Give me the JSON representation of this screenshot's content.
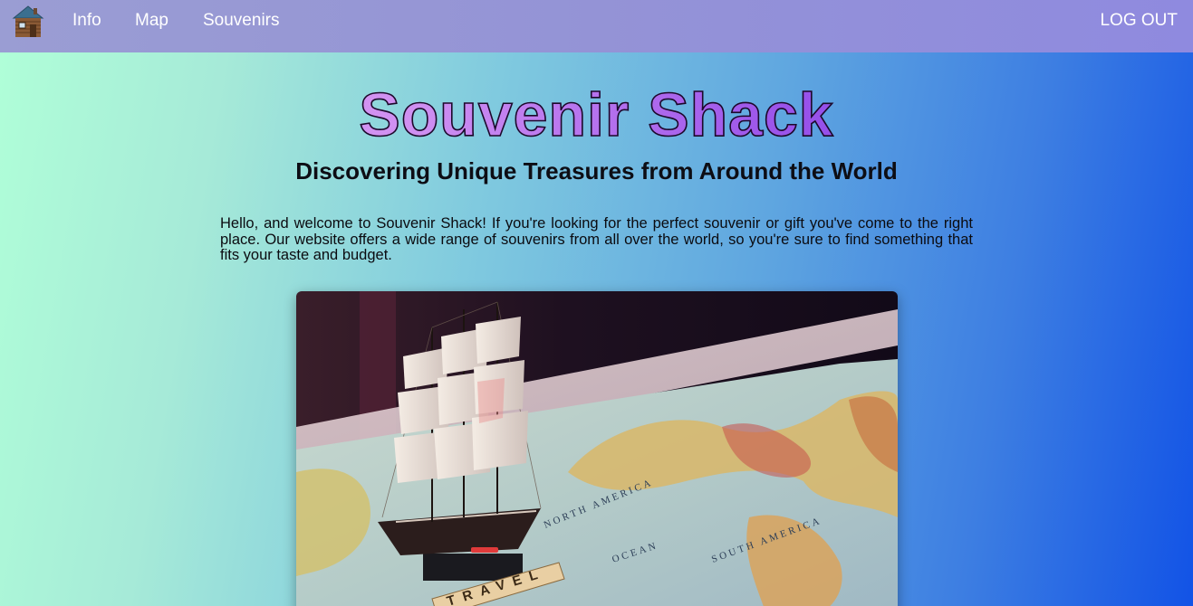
{
  "nav": {
    "logo_icon": "log-cabin-icon",
    "links": [
      {
        "label": "Info"
      },
      {
        "label": "Map"
      },
      {
        "label": "Souvenirs"
      }
    ],
    "logout_label": "LOG OUT"
  },
  "header": {
    "title": "Souvenir Shack",
    "subtitle": "Discovering Unique Treasures from Around the World"
  },
  "intro": {
    "text": "Hello, and welcome to Souvenir Shack! If you're looking for the perfect souvenir or gift you've come to the right place. Our website offers a wide range of souvenirs from all over the world, so you're sure to find something that fits your taste and budget."
  },
  "hero": {
    "image": "model-ship-on-world-map-image",
    "map_labels": [
      "NORTH AMERICA",
      "OCEAN",
      "SOUTH AMERICA"
    ],
    "tile_word": "TRAVEL"
  },
  "colors": {
    "nav_background": "#9595d6",
    "title_start": "#e7a6f4",
    "title_end": "#6c2fe4"
  }
}
